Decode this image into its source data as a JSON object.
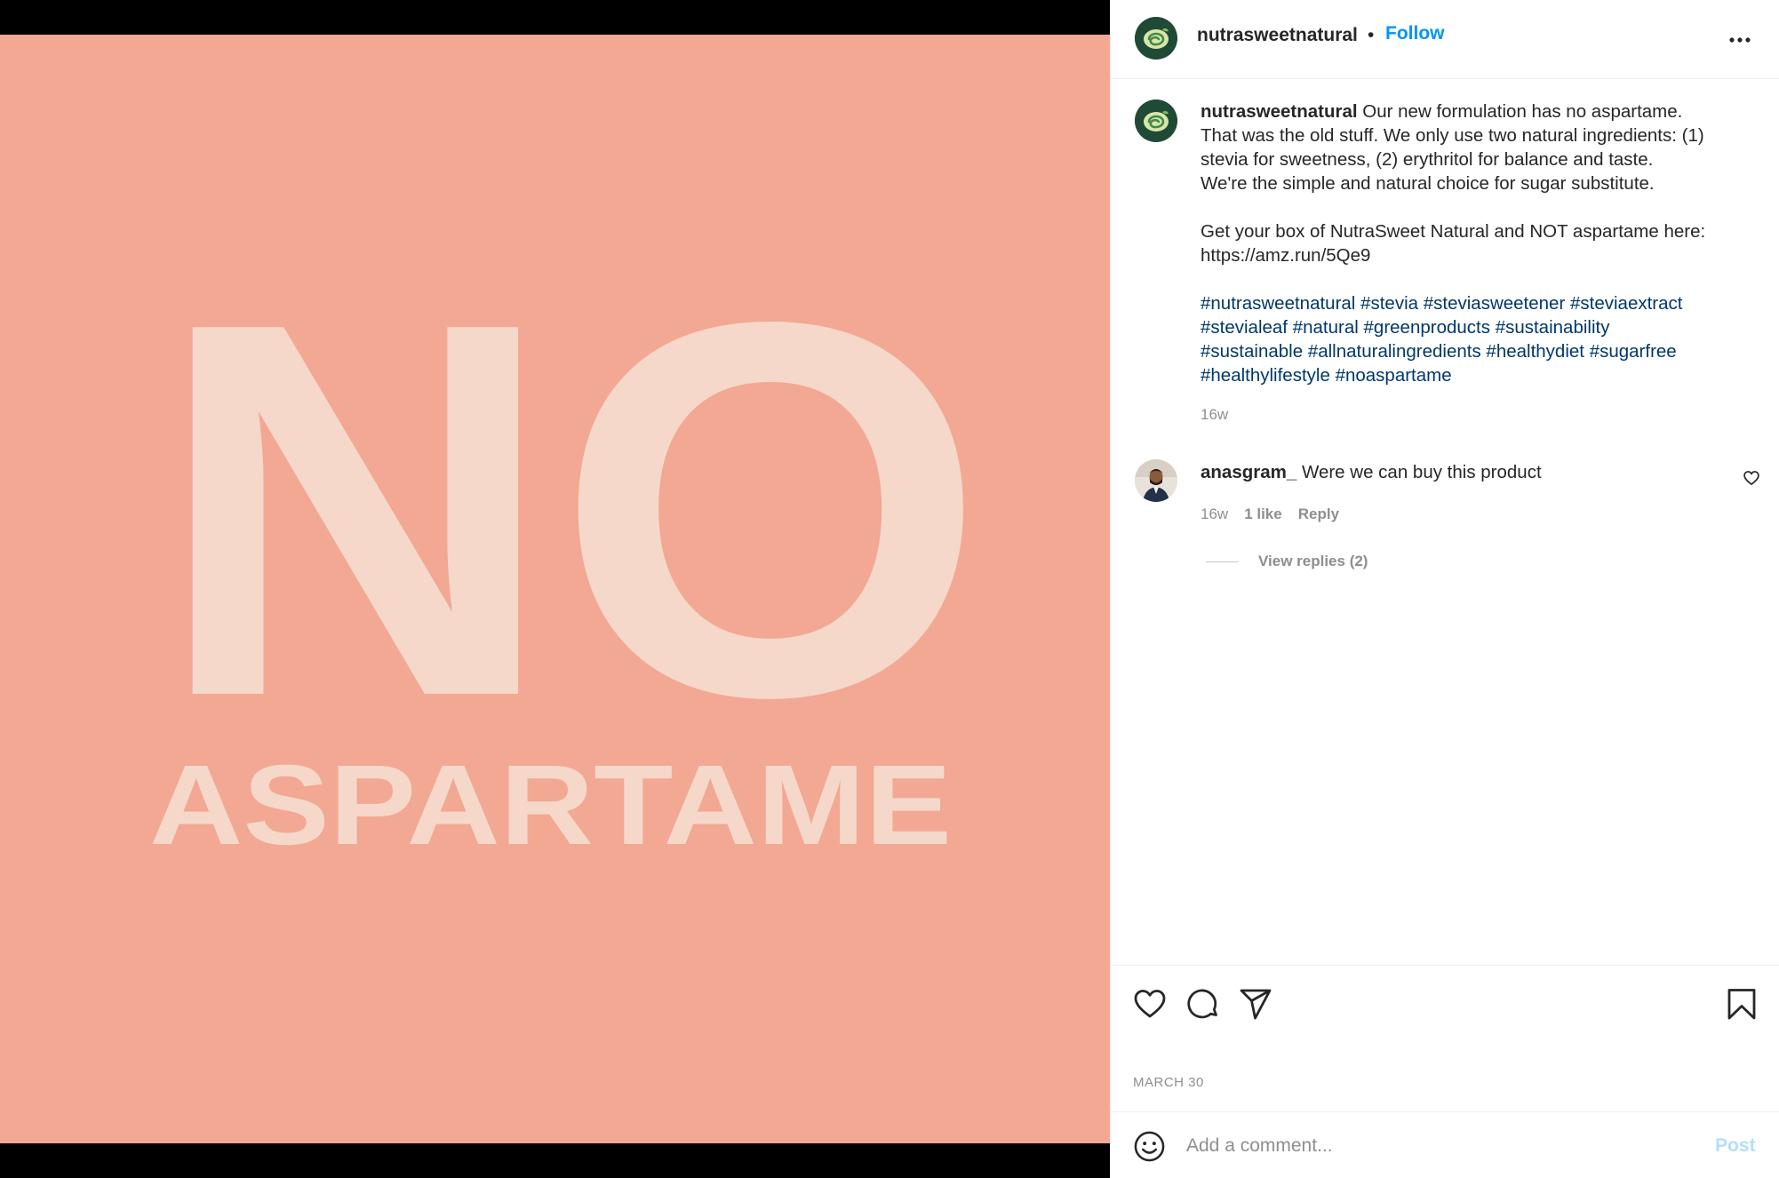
{
  "media": {
    "headline": "NO",
    "subline": "ASPARTAME",
    "background_color": "#f2a892",
    "text_color": "#f6d8ca"
  },
  "header": {
    "username": "nutrasweetnatural",
    "separator": "•",
    "follow_label": "Follow",
    "more_icon": "more-horizontal-icon"
  },
  "caption": {
    "username": "nutrasweetnatural",
    "lines": [
      "Our new formulation has no aspartame.",
      "That was the old stuff. We only use two natural ingredients: (1)",
      "stevia for sweetness, (2) erythritol for balance and taste.",
      "We're the simple and natural choice for sugar substitute.",
      "Get your box of NutraSweet Natural and NOT aspartame here:",
      "https://amz.run/5Qe9"
    ],
    "hashtags": [
      "#nutrasweetnatural",
      "#stevia",
      "#steviasweetener",
      "#steviaextract",
      "#stevialeaf",
      "#natural",
      "#greenproducts",
      "#sustainability",
      "#sustainable",
      "#allnaturalingredients",
      "#healthydiet",
      "#sugarfree",
      "#healthylifestyle",
      "#noaspartame"
    ],
    "time": "16w"
  },
  "comment": {
    "username": "anasgram_",
    "text": "Were we can buy this product",
    "time": "16w",
    "likes": "1 like",
    "reply_label": "Reply",
    "view_replies": "View replies (2)"
  },
  "actions": {
    "icons": [
      "heart-icon",
      "comment-icon",
      "share-icon",
      "bookmark-icon"
    ],
    "date": "MARCH 30"
  },
  "add_comment": {
    "placeholder": "Add a comment...",
    "post_label": "Post"
  },
  "colors": {
    "link_blue": "#0095f6",
    "hashtag_blue": "#00376b",
    "muted": "#8e8e8e",
    "post_disabled": "#b2dffc"
  }
}
